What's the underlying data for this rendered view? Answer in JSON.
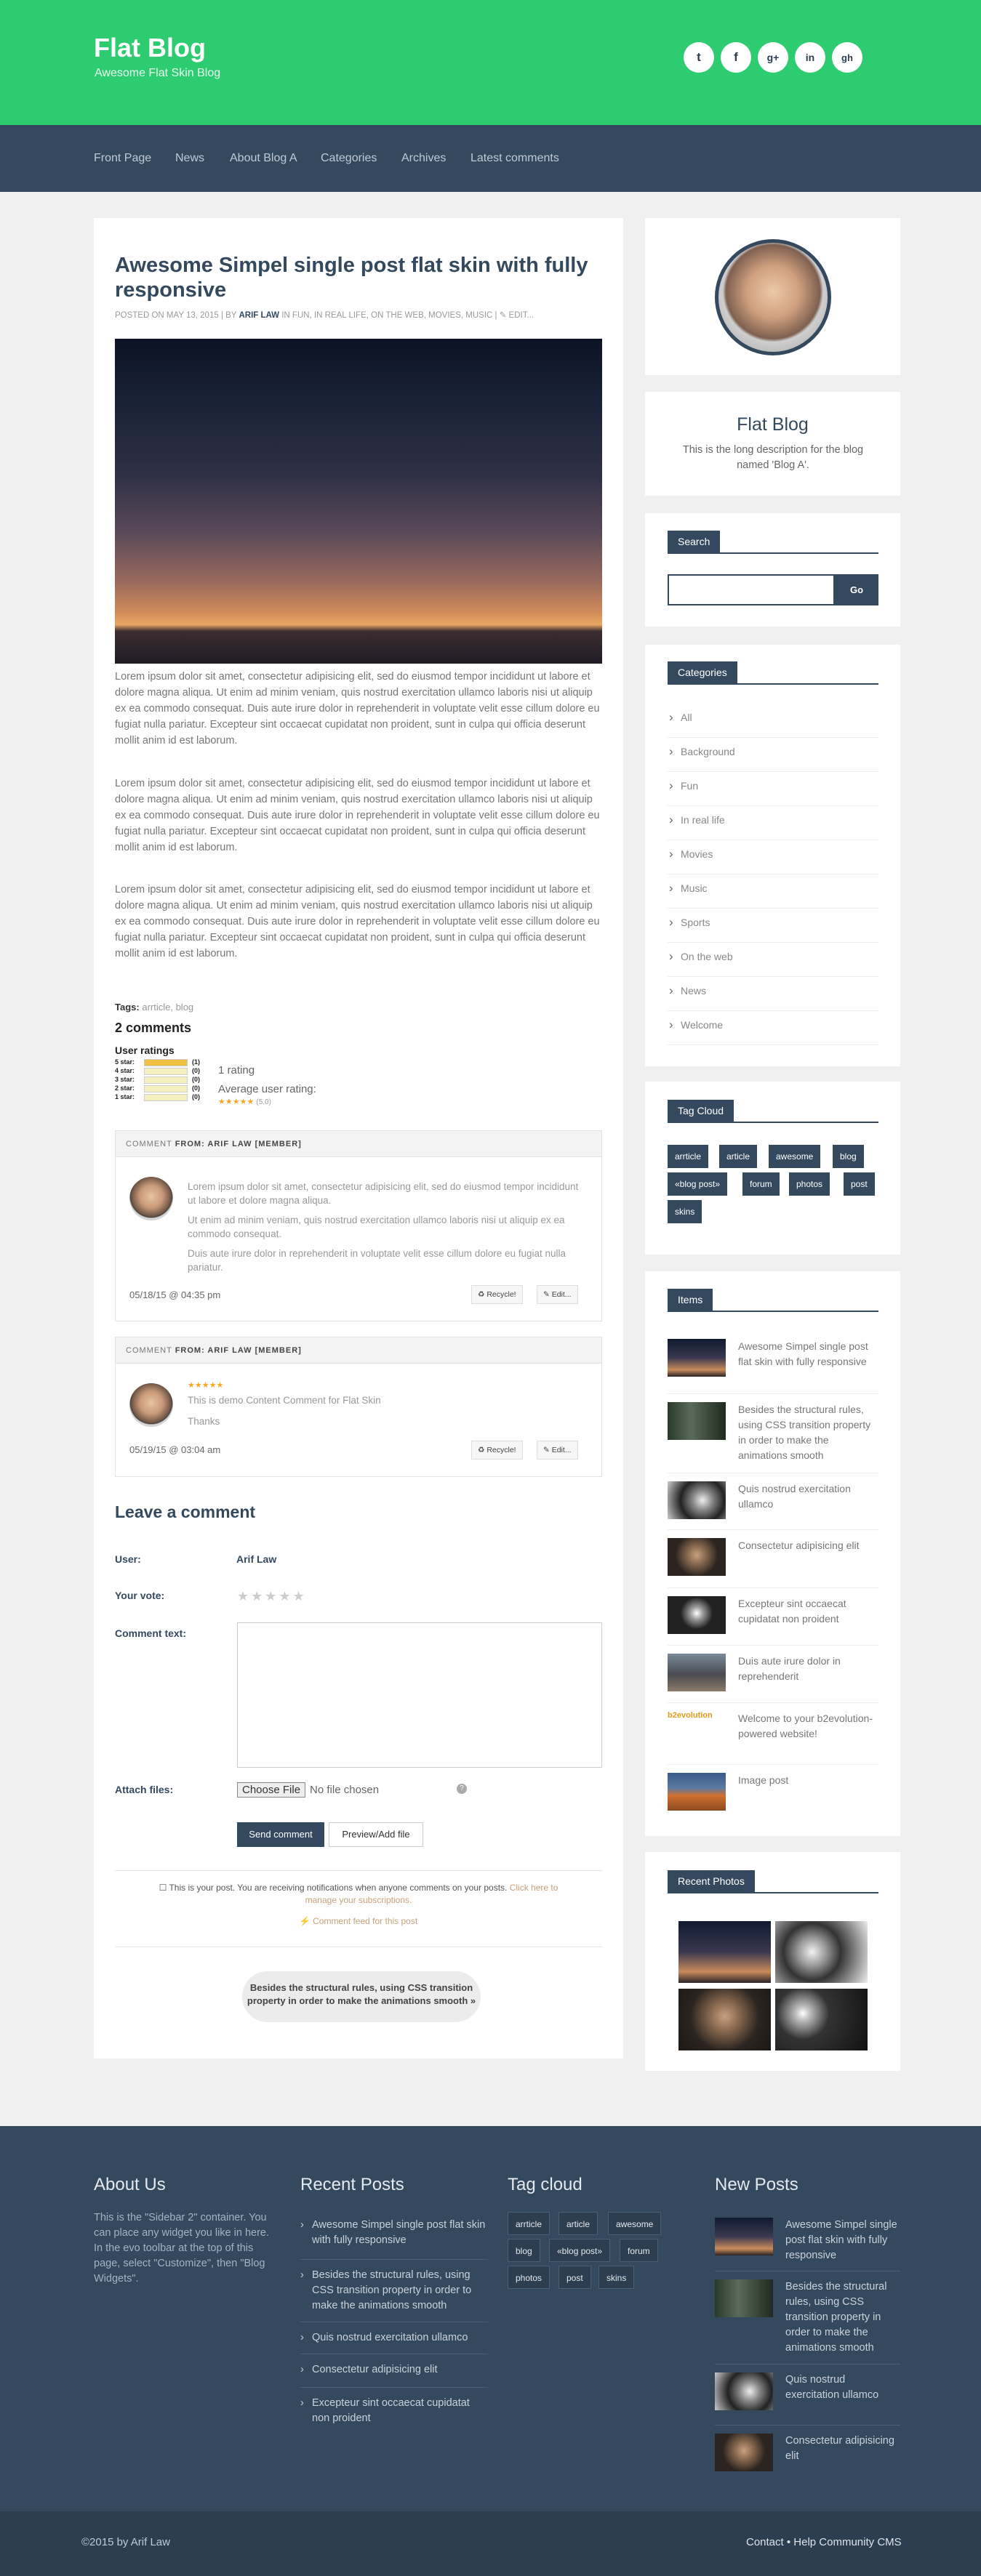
{
  "header": {
    "title": "Flat Blog",
    "tagline": "Awesome Flat Skin Blog",
    "social": [
      "twitter-icon",
      "facebook-icon",
      "google-plus-icon",
      "linkedin-icon",
      "github-icon"
    ],
    "social_glyphs": [
      "t",
      "f",
      "g+",
      "in",
      "gh"
    ]
  },
  "nav": {
    "items": [
      "Front Page",
      "News",
      "About Blog A",
      "Categories",
      "Archives",
      "Latest comments"
    ]
  },
  "post": {
    "title": "Awesome Simpel single post flat skin with fully responsive",
    "meta_prefix": "POSTED ON MAY 13, 2015 | BY ",
    "meta_author": "ARIF LAW",
    "meta_suffix": " IN FUN, IN REAL LIFE, ON THE WEB, MOVIES, MUSIC | ✎ EDIT...",
    "paragraph": "Lorem ipsum dolor sit amet, consectetur adipisicing elit, sed do eiusmod tempor incididunt ut labore et dolore magna aliqua. Ut enim ad minim veniam, quis nostrud exercitation ullamco laboris nisi ut aliquip ex ea commodo consequat. Duis aute irure dolor in reprehenderit in voluptate velit esse cillum dolore eu fugiat nulla pariatur. Excepteur sint occaecat cupidatat non proident, sunt in culpa qui officia deserunt mollit anim id est laborum.",
    "tags_label": "Tags:",
    "tags_list": "arrticle, blog",
    "comment_count": "2 comments",
    "ratings_title": "User ratings",
    "ratings": [
      {
        "label": "5 star:",
        "count": "(1)",
        "fill": 1
      },
      {
        "label": "4 star:",
        "count": "(0)",
        "fill": 0
      },
      {
        "label": "3 star:",
        "count": "(0)",
        "fill": 0
      },
      {
        "label": "2 star:",
        "count": "(0)",
        "fill": 0
      },
      {
        "label": "1 star:",
        "count": "(0)",
        "fill": 0
      }
    ],
    "rating_total": "1 rating",
    "avg_label": "Average user rating:",
    "avg_stars": "★★★★★",
    "avg_value": "(5.0)"
  },
  "comments": [
    {
      "head_prefix": "COMMENT ",
      "head_from": "FROM:",
      "head_author": " ARIF LAW [MEMBER]",
      "paragraphs": [
        "Lorem ipsum dolor sit amet, consectetur adipisicing elit, sed do eiusmod tempor incididunt ut labore et dolore magna aliqua.",
        "Ut enim ad minim veniam, quis nostrud exercitation ullamco laboris nisi ut aliquip ex ea commodo consequat.",
        "Duis aute irure dolor in reprehenderit in voluptate velit esse cillum dolore eu fugiat nulla pariatur."
      ],
      "date": "05/18/15 @ 04:35 pm",
      "recycle": "♻ Recycle!",
      "edit": "✎ Edit..."
    },
    {
      "head_prefix": "COMMENT ",
      "head_from": "FROM:",
      "head_author": " ARIF LAW [MEMBER]",
      "stars": "★★★★★",
      "text": "This is demo Content Comment for Flat Skin",
      "thanks": "Thanks",
      "date": "05/19/15 @ 03:04 am",
      "recycle": "♻ Recycle!",
      "edit": "✎ Edit..."
    }
  ],
  "form": {
    "heading": "Leave a comment",
    "user_label": "User:",
    "user_value": "Arif Law",
    "vote_label": "Your vote:",
    "vote_stars": "★★★★★",
    "comment_label": "Comment text:",
    "attach_label": "Attach files:",
    "choose_file": "Choose File",
    "no_file": "No file chosen",
    "help": "?",
    "send": "Send comment",
    "preview": "Preview/Add file",
    "notice_text": "☐ This is your post. You are receiving notifications when anyone comments on your posts. ",
    "notice_link": "Click here to manage your subscriptions.",
    "feed": "⚡ Comment feed for this post",
    "next_post": "Besides the structural rules, using CSS transition property in order to make the animations smooth »"
  },
  "sidebar": {
    "blog_title": "Flat Blog",
    "blog_desc": "This is the long description for the blog named 'Blog A'.",
    "search_title": "Search",
    "search_button": "Go",
    "categories_title": "Categories",
    "categories": [
      "All",
      "Background",
      "Fun",
      "In real life",
      "Movies",
      "Music",
      "Sports",
      "On the web",
      "News",
      "Welcome"
    ],
    "tagcloud_title": "Tag Cloud",
    "tags": [
      "arrticle",
      "article",
      "awesome",
      "blog",
      "«blog post»",
      "forum",
      "photos",
      "post",
      "skins"
    ],
    "items_title": "Items",
    "items": [
      "Awesome Simpel single post flat skin with fully responsive",
      "Besides the structural rules, using CSS transition property in order to make the animations smooth",
      "Quis nostrud exercitation ullamco",
      "Consectetur adipisicing elit",
      "Excepteur sint occaecat cupidatat non proident",
      "Duis aute irure dolor in reprehenderit",
      "Welcome to your b2evolution-powered website!",
      "Image post"
    ],
    "b2evo_logo": "b2evolution",
    "photos_title": "Recent Photos"
  },
  "footer": {
    "about_title": "About Us",
    "about_text": "This is the \"Sidebar 2\" container. You can place any widget you like in here. In the evo toolbar at the top of this page, select \"Customize\", then \"Blog Widgets\".",
    "recent_title": "Recent Posts",
    "recent_posts": [
      "Awesome Simpel single post flat skin with fully responsive",
      "Besides the structural rules, using CSS transition property in order to make the animations smooth",
      "Quis nostrud exercitation ullamco",
      "Consectetur adipisicing elit",
      "Excepteur sint occaecat cupidatat non proident"
    ],
    "tagcloud_title": "Tag cloud",
    "tags": [
      "arrticle",
      "article",
      "awesome",
      "blog",
      "«blog post»",
      "forum",
      "photos",
      "post",
      "skins"
    ],
    "new_title": "New Posts",
    "new_posts": [
      "Awesome Simpel single post flat skin with fully responsive",
      "Besides the structural rules, using CSS transition property in order to make the animations smooth",
      "Quis nostrud exercitation ullamco",
      "Consectetur adipisicing elit"
    ],
    "copyright": "©2015 by Arif Law",
    "links": "Contact • Help Community CMS"
  },
  "colors": {
    "header": "#2ecc71",
    "dark": "#34495e",
    "darker": "#2c3e50",
    "accent_star": "#f5a623"
  }
}
